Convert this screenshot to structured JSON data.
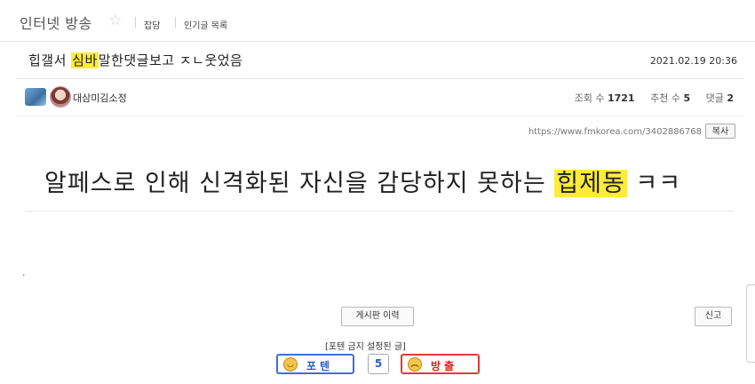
{
  "header": {
    "board_name": "인터넷 방송",
    "links": [
      "잡담",
      "인기글 목록"
    ]
  },
  "post": {
    "title_before": "힙갤서 ",
    "title_highlight": "심바",
    "title_after": "말한댓글보고 ㅈㄴ웃었음",
    "date": "2021.02.19 20:36",
    "author": "대삼미김소정",
    "stats": {
      "views_label": "조회 수",
      "views": "1721",
      "recommend_label": "추천 수",
      "recommend": "5",
      "comments_label": "댓글",
      "comments": "2"
    },
    "url": "https://www.fmkorea.com/3402886768",
    "copy_label": "복사",
    "body_before": "알페스로 인해 신격화된 자신을 감당하지 못하는 ",
    "body_highlight": "힙제동",
    "body_after": " ㅋㅋ",
    "dot": "."
  },
  "actions": {
    "history_label": "게시판 이력",
    "report_label": "신고",
    "locked_note": "[포텐 금지 설정된 글]",
    "vote_up_label": "포텐",
    "vote_count": "5",
    "vote_down_label": "방출"
  },
  "colors": {
    "highlight": "#ffeb3b",
    "vote_up": "#3a6fd8",
    "vote_down": "#e23a3a"
  },
  "icons": {
    "favorite": "star-icon",
    "vote_up": "smile-face-icon",
    "vote_down": "angry-face-icon"
  }
}
